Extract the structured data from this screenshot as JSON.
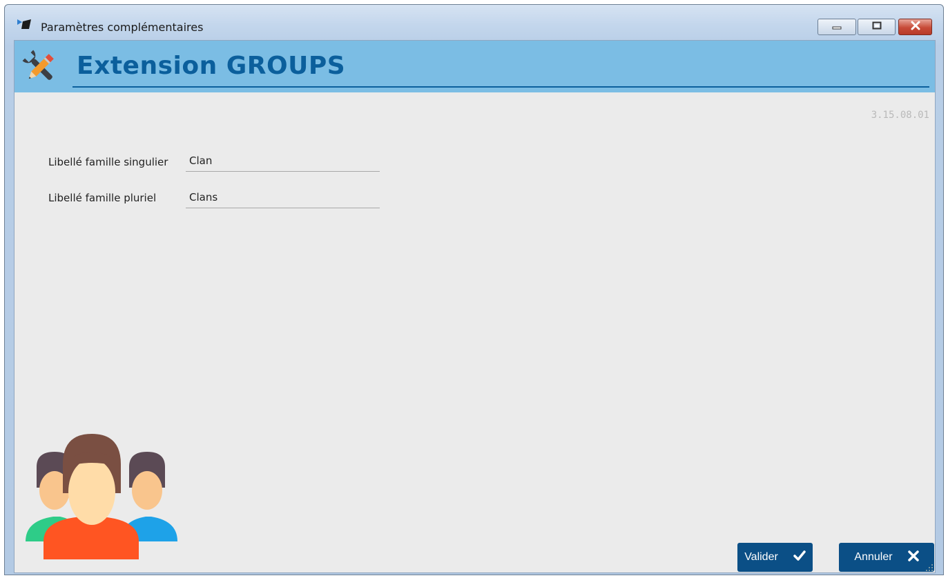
{
  "window": {
    "title": "Paramètres complémentaires",
    "icons": {
      "app": "app-logo-icon",
      "minimize": "minimize-icon",
      "maximize": "maximize-icon",
      "close": "close-icon"
    }
  },
  "header": {
    "title": "Extension GROUPS",
    "icon": "tools-icon",
    "version": "3.15.08.01"
  },
  "form": {
    "fields": [
      {
        "label": "Libellé famille singulier",
        "value": "Clan"
      },
      {
        "label": "Libellé famille pluriel",
        "value": "Clans"
      }
    ]
  },
  "illustration": {
    "icon": "users-group-icon"
  },
  "buttons": {
    "validate": {
      "label": "Valider",
      "icon": "checkmark-icon"
    },
    "cancel": {
      "label": "Annuler",
      "icon": "close-icon"
    }
  },
  "colors": {
    "header_band": "#7bbde4",
    "header_text": "#0b5f9c",
    "button_bg": "#0b4f86",
    "client_bg": "#ebebeb",
    "close_button": "#c74b38"
  }
}
